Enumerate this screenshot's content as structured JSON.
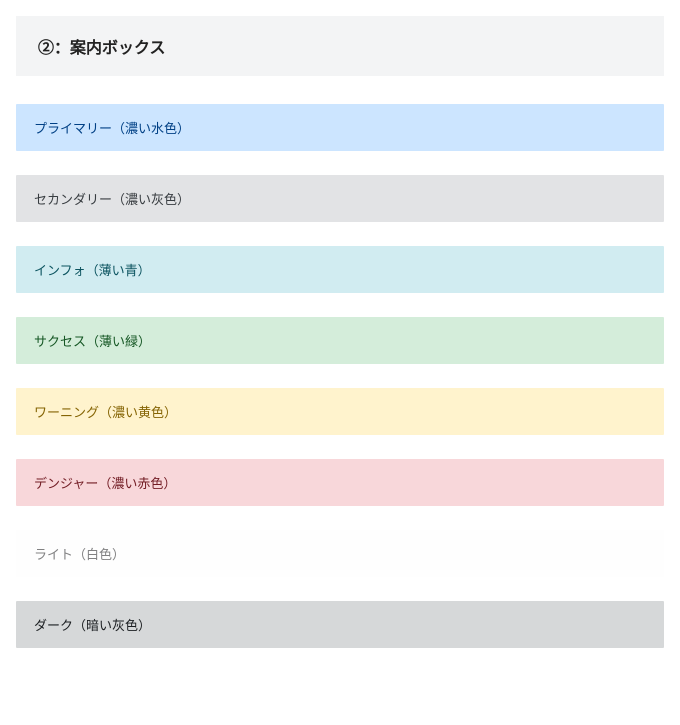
{
  "header": {
    "title": "②：案内ボックス"
  },
  "alerts": {
    "primary": "プライマリー（濃い水色）",
    "secondary": "セカンダリー（濃い灰色）",
    "info": "インフォ（薄い青）",
    "success": "サクセス（薄い緑）",
    "warning": "ワーニング（濃い黄色）",
    "danger": "デンジャー（濃い赤色）",
    "light": "ライト（白色）",
    "dark": "ダーク（暗い灰色）"
  }
}
